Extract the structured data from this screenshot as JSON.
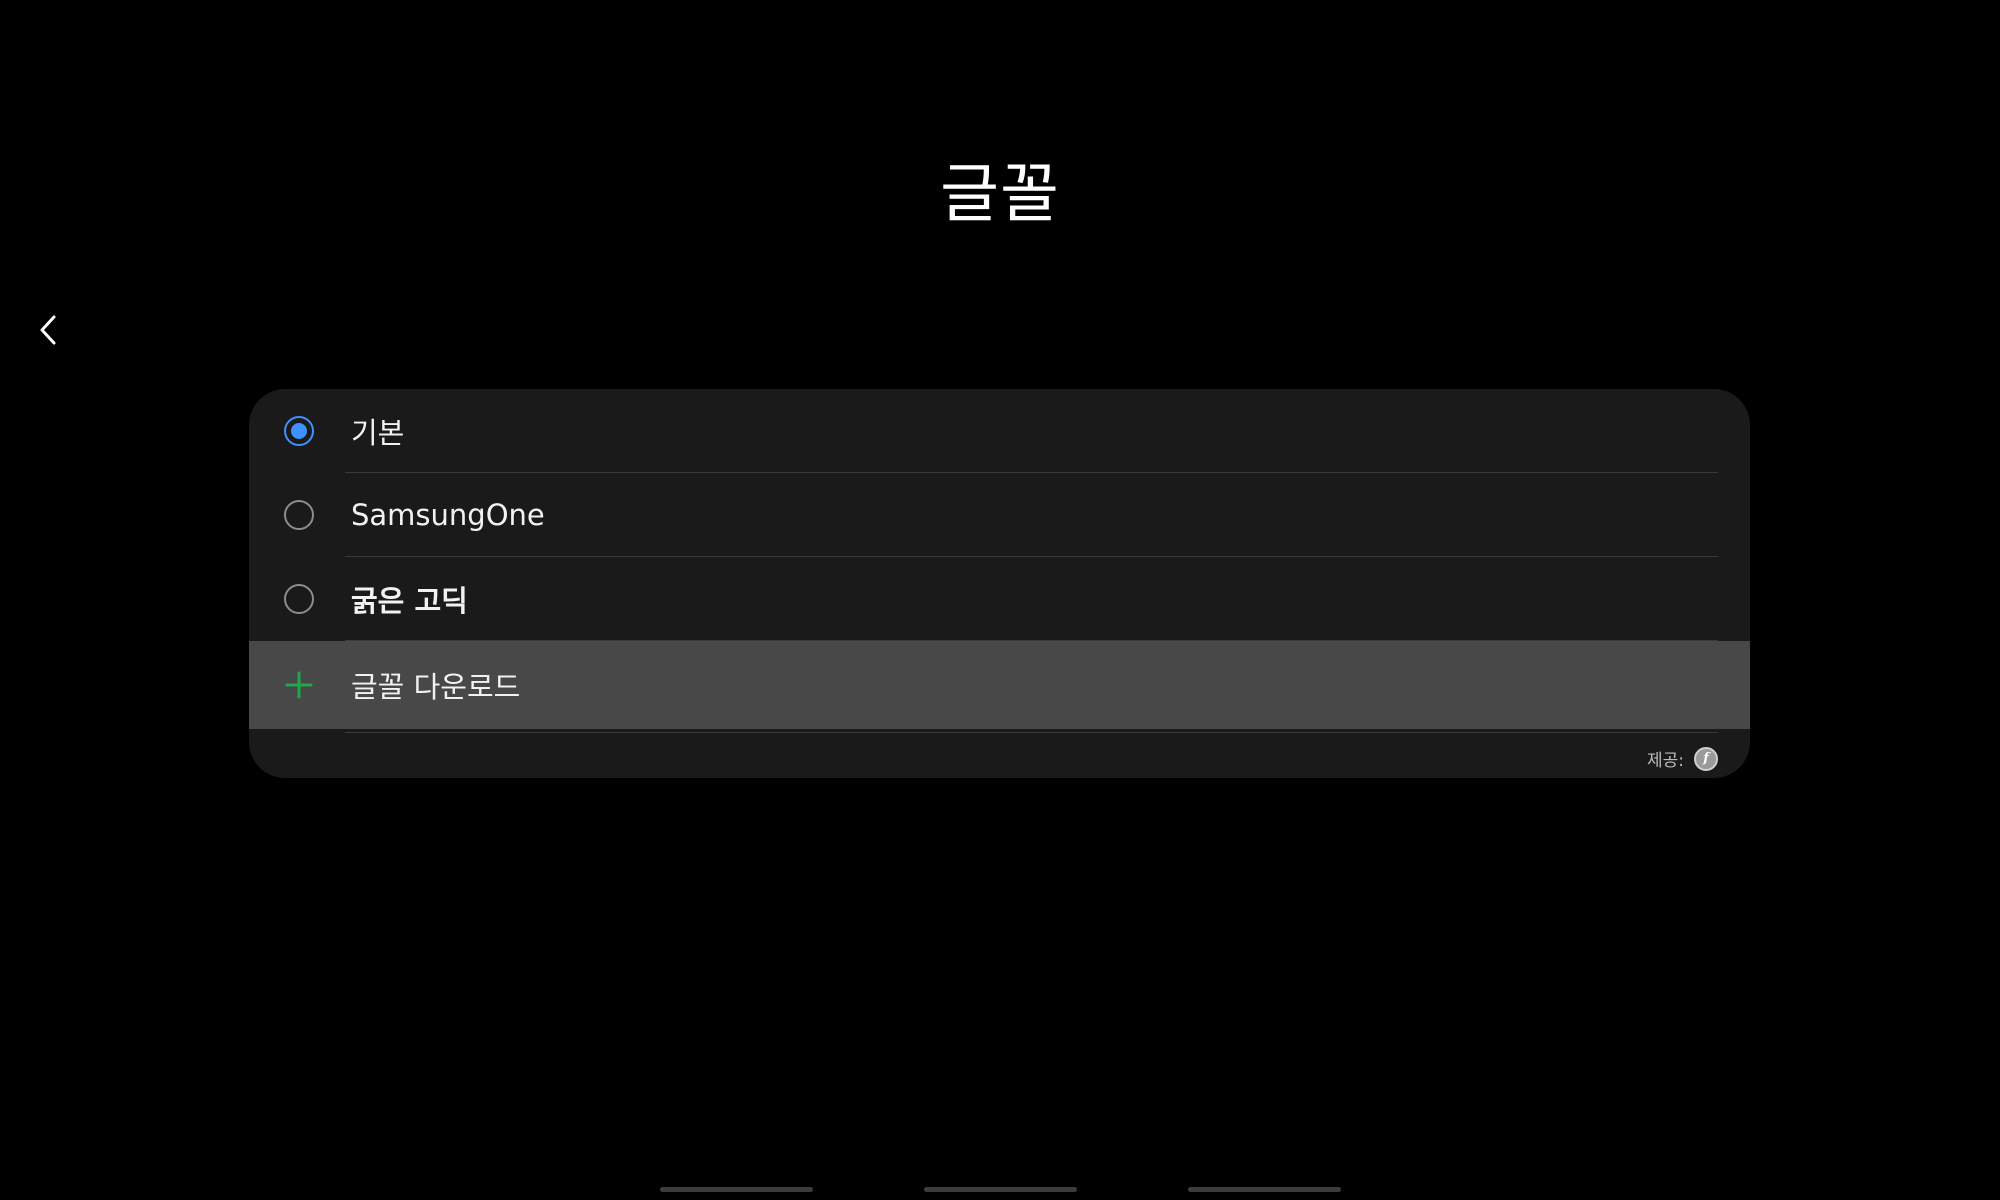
{
  "header": {
    "title": "글꼴",
    "back_icon": "chevron-left-icon"
  },
  "font_options": [
    {
      "label": "기본",
      "selected": true,
      "bold": false
    },
    {
      "label": "SamsungOne",
      "selected": false,
      "bold": false
    },
    {
      "label": "굵은 고딕",
      "selected": false,
      "bold": true
    }
  ],
  "download": {
    "label": "글꼴 다운로드",
    "icon": "plus-icon"
  },
  "footer": {
    "provider_label": "제공:",
    "provider_logo_text": "f",
    "provider_icon": "provider-logo-icon"
  },
  "colors": {
    "background": "#000000",
    "card": "#1a1a1a",
    "highlight_row": "#484848",
    "accent_blue": "#3e91ff",
    "plus_green": "#1ea94a"
  }
}
